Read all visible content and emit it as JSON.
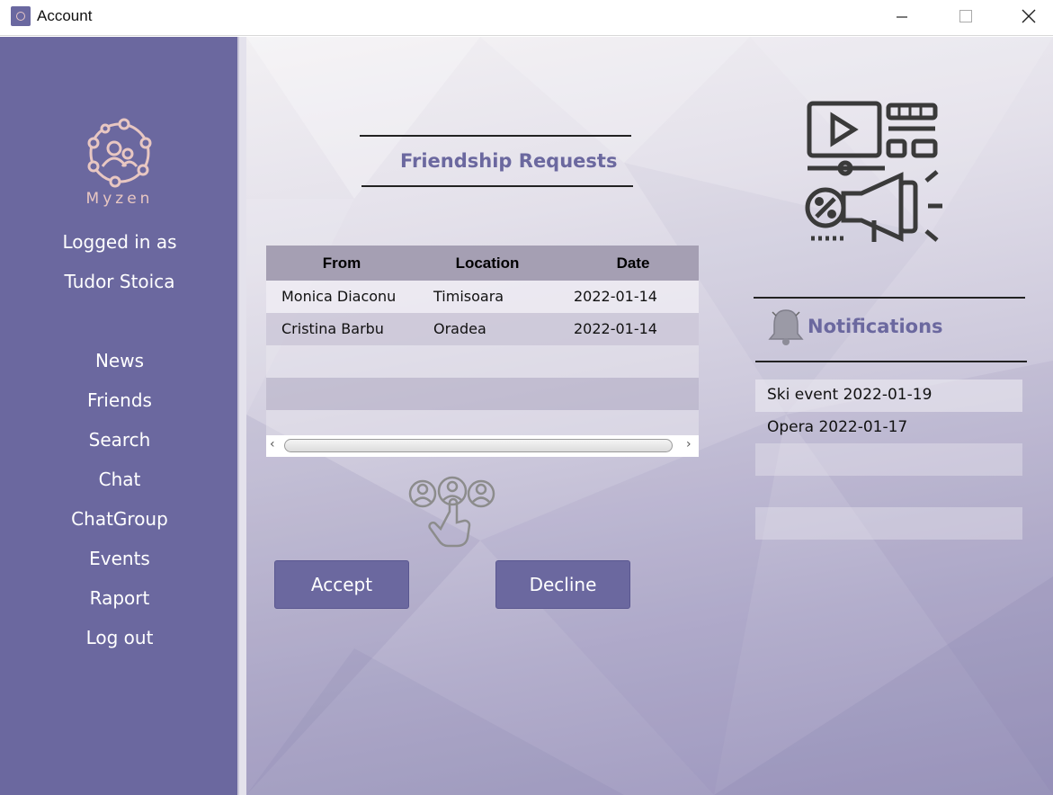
{
  "window": {
    "title": "Account"
  },
  "sidebar": {
    "logo_text": "Myzen",
    "logged_in_label": "Logged in as",
    "user_name": "Tudor Stoica",
    "nav": [
      "News",
      "Friends",
      "Search",
      "Chat",
      "ChatGroup",
      "Events",
      "Raport",
      "Log out"
    ]
  },
  "requests": {
    "title": "Friendship Requests",
    "columns": [
      "From",
      "Location",
      "Date"
    ],
    "rows": [
      [
        "Monica Diaconu",
        "Timisoara",
        "2022-01-14"
      ],
      [
        "Cristina Barbu",
        "Oradea",
        "2022-01-14"
      ]
    ],
    "accept_label": "Accept",
    "decline_label": "Decline"
  },
  "notifications": {
    "title": "Notifications",
    "items": [
      "Ski event  2022-01-19",
      "Opera  2022-01-17"
    ]
  },
  "colors": {
    "accent": "#6b689f",
    "header_bg": "#a59fb3",
    "logo": "#e8c7c2"
  }
}
